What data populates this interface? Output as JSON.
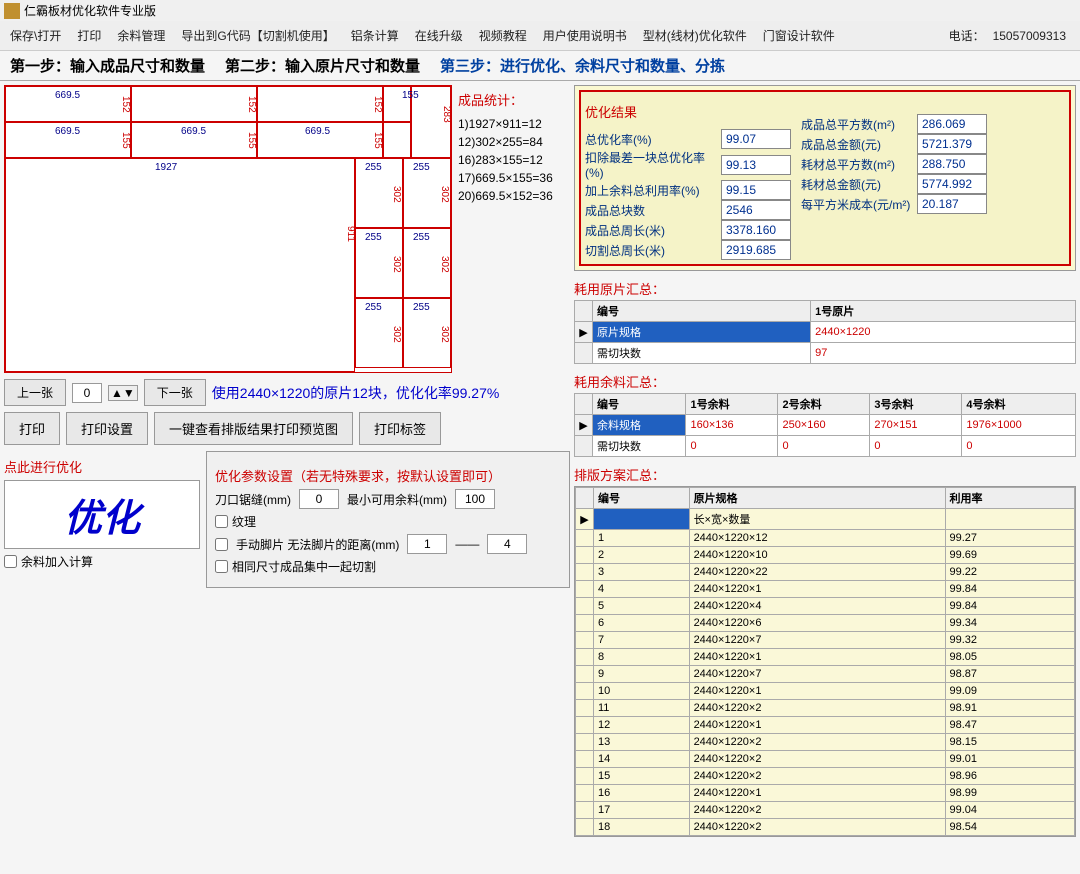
{
  "titlebar": {
    "title": "仁霸板材优化软件专业版"
  },
  "toolbar": {
    "items": [
      "保存\\打开",
      "打印",
      "余料管理",
      "导出到G代码【切割机使用】",
      "铝条计算",
      "在线升级",
      "视频教程",
      "用户使用说明书",
      "型材(线材)优化软件",
      "门窗设计软件"
    ],
    "phone_label": "电话：",
    "phone": "15057009313"
  },
  "tabs": {
    "t1": "第一步：输入成品尺寸和数量",
    "t2": "第二步：输入原片尺寸和数量",
    "t3": "第三步：进行优化、余料尺寸和数量、分拣"
  },
  "diagram": {
    "w": "1927",
    "cells": {
      "a": "669.5",
      "b": "669.5",
      "c": "669.5",
      "d": "669.5",
      "v1": "155",
      "v2": "911",
      "v3": "302",
      "v4": "283",
      "v5": "152",
      "p255": "255"
    }
  },
  "nav": {
    "prev": "上一张",
    "next": "下一张",
    "page": "0",
    "summary": "使用2440×1220的原片12块，优化化率99.27%"
  },
  "buttons": {
    "print": "打印",
    "printset": "打印设置",
    "preview": "一键查看排版结果打印预览图",
    "label": "打印标签"
  },
  "optimize": {
    "click_title": "点此进行优化",
    "big": "优化",
    "add_rem": "余料加入计算"
  },
  "params": {
    "title": "优化参数设置（若无特殊要求，按默认设置即可）",
    "kerf_label": "刀口锯缝(mm)",
    "kerf": "0",
    "minrem_label": "最小可用余料(mm)",
    "minrem": "100",
    "texture": "纹理",
    "manual_label": "手动脚片 无法脚片的距离(mm)",
    "m1": "1",
    "m2": "4",
    "samecut": "相同尺寸成品集中一起切割"
  },
  "stats": {
    "title": "成品统计：",
    "lines": [
      "1)1927×911=12",
      "12)302×255=84",
      "16)283×155=12",
      "17)669.5×155=36",
      "20)669.5×152=36"
    ]
  },
  "result": {
    "title": "优化结果",
    "rows_l": [
      {
        "k": "总优化率(%)",
        "v": "99.07"
      },
      {
        "k": "扣除最差一块总优化率(%)",
        "v": "99.13"
      },
      {
        "k": "加上余料总利用率(%)",
        "v": "99.15"
      },
      {
        "k": "成品总块数",
        "v": "2546"
      },
      {
        "k": "成品总周长(米)",
        "v": "3378.160"
      },
      {
        "k": "切割总周长(米)",
        "v": "2919.685"
      }
    ],
    "rows_r": [
      {
        "k": "成品总平方数(m²)",
        "v": "286.069"
      },
      {
        "k": "成品总金额(元)",
        "v": "5721.379"
      },
      {
        "k": "耗材总平方数(m²)",
        "v": "288.750"
      },
      {
        "k": "耗材总金额(元)",
        "v": "5774.992"
      },
      {
        "k": "每平方米成本(元/m²)",
        "v": "20.187"
      }
    ]
  },
  "usage_sheet": {
    "title": "耗用原片汇总：",
    "h1": "编号",
    "h2": "1号原片",
    "r1k": "原片规格",
    "r1v": "2440×1220",
    "r2k": "需切块数",
    "r2v": "97"
  },
  "rem_sheet": {
    "title": "耗用余料汇总：",
    "hdrs": [
      "编号",
      "1号余料",
      "2号余料",
      "3号余料",
      "4号余料"
    ],
    "r1": [
      "余料规格",
      "160×136",
      "250×160",
      "270×151",
      "1976×1000"
    ],
    "r2": [
      "需切块数",
      "0",
      "0",
      "0",
      "0"
    ]
  },
  "layout": {
    "title": "排版方案汇总：",
    "hdrs": [
      "编号",
      "原片规格",
      "利用率"
    ],
    "subhead": "长×宽×数量",
    "rows": [
      {
        "n": "1",
        "s": "2440×1220×12",
        "u": "99.27"
      },
      {
        "n": "2",
        "s": "2440×1220×10",
        "u": "99.69"
      },
      {
        "n": "3",
        "s": "2440×1220×22",
        "u": "99.22"
      },
      {
        "n": "4",
        "s": "2440×1220×1",
        "u": "99.84"
      },
      {
        "n": "5",
        "s": "2440×1220×4",
        "u": "99.84"
      },
      {
        "n": "6",
        "s": "2440×1220×6",
        "u": "99.34"
      },
      {
        "n": "7",
        "s": "2440×1220×7",
        "u": "99.32"
      },
      {
        "n": "8",
        "s": "2440×1220×1",
        "u": "98.05"
      },
      {
        "n": "9",
        "s": "2440×1220×7",
        "u": "98.87"
      },
      {
        "n": "10",
        "s": "2440×1220×1",
        "u": "99.09"
      },
      {
        "n": "11",
        "s": "2440×1220×2",
        "u": "98.91"
      },
      {
        "n": "12",
        "s": "2440×1220×1",
        "u": "98.47"
      },
      {
        "n": "13",
        "s": "2440×1220×2",
        "u": "98.15"
      },
      {
        "n": "14",
        "s": "2440×1220×2",
        "u": "99.01"
      },
      {
        "n": "15",
        "s": "2440×1220×2",
        "u": "98.96"
      },
      {
        "n": "16",
        "s": "2440×1220×1",
        "u": "98.99"
      },
      {
        "n": "17",
        "s": "2440×1220×2",
        "u": "99.04"
      },
      {
        "n": "18",
        "s": "2440×1220×2",
        "u": "98.54"
      }
    ]
  }
}
